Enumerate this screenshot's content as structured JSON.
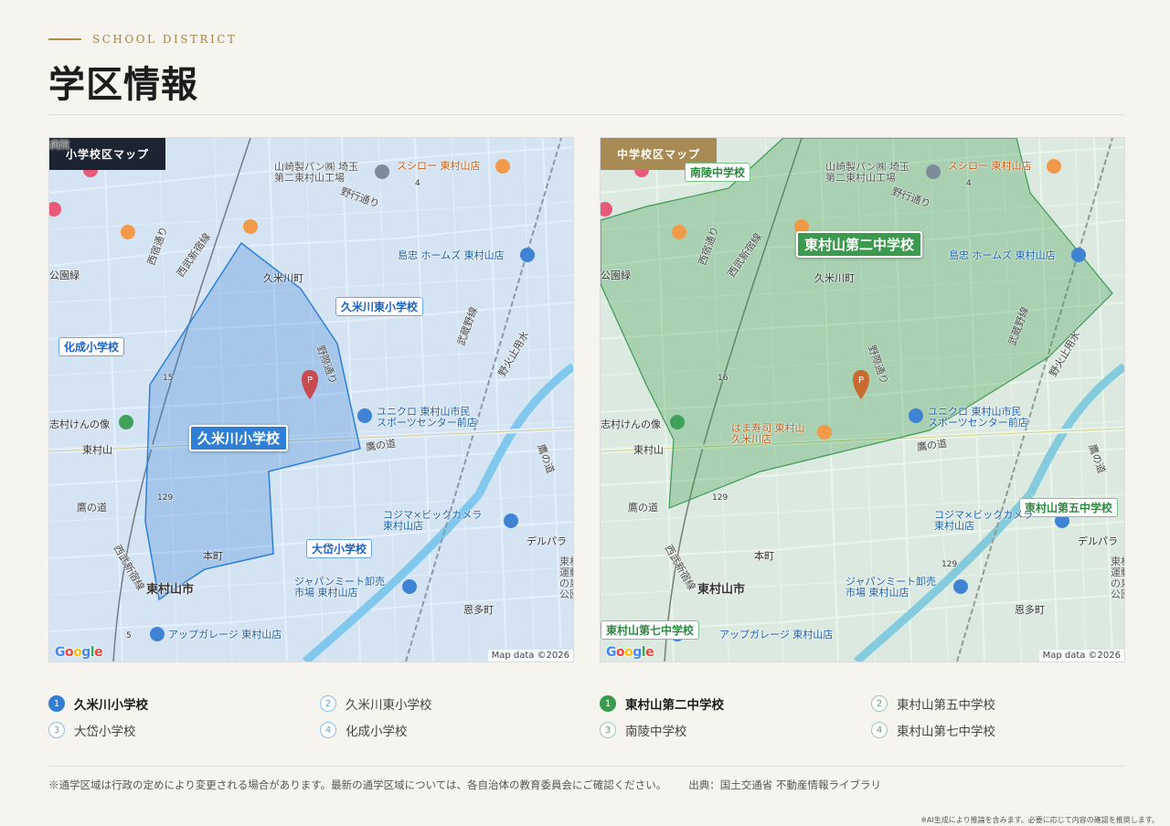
{
  "header": {
    "eyebrow": "SCHOOL DISTRICT",
    "title": "学区情報"
  },
  "maps": {
    "elementary": {
      "tag": "小学校区マップ",
      "primary_school": "久米川小学校",
      "school_labels": [
        "久米川東小学校",
        "化成小学校",
        "大岱小学校"
      ],
      "district_color": "#2f7fd6"
    },
    "middle": {
      "tag": "中学校区マップ",
      "primary_school": "東村山第二中学校",
      "school_labels": [
        "南陵中学校",
        "東村山第五中学校",
        "東村山第七中学校"
      ],
      "district_color": "#3c9a4f"
    },
    "common_labels": {
      "poi_bakery": "山崎製パン㈱ 埼玉\n第二東村山工場",
      "sushiro": "スシロー 東村山店",
      "shimachu": "島忠 ホームズ 東村山店",
      "uniqlo": "ユニクロ 東村山市民\nスポーツセンター前店",
      "kojima": "コジマ×ビックカメラ\n東村山店",
      "japan_meat": "ジャパンミート卸売\n市場 東村山店",
      "upgarage": "アップガレージ 東村山店",
      "hamazushi": "はま寿司 東村山\n久米川店",
      "kumegawa_town": "久米川町",
      "honmachi": "本町",
      "onta": "恩多町",
      "higashimurayama_city": "東村山市",
      "higashimurayama_station": "東村山",
      "nishijuku_dori": "西宿通り",
      "seibu_shinjuku": "西武新宿線",
      "seibu_shinjuku2": "西武新宿線",
      "musashino_line": "武蔵野線",
      "nobidome": "野火止用水",
      "yakou_dori": "野行通り",
      "nobi_dori": "野際通り",
      "takanomichi": "鷹の道",
      "takanomichi2": "鷹の道",
      "takanomichi3": "鷹の道",
      "shimura_ken": "志村けんの像",
      "derupara": "デルパラ",
      "park_edge": "公園緑",
      "hospital_edge": "病院",
      "higashi_edge": "東村\n運動\nの泉\n公園",
      "route_4": "4",
      "route_15": "15",
      "route_16": "16",
      "route_129": "129",
      "route_5": "5"
    },
    "attribution": "Map data ©2026",
    "google": [
      "G",
      "o",
      "o",
      "g",
      "l",
      "e"
    ]
  },
  "legend": {
    "elementary": [
      "久米川小学校",
      "久米川東小学校",
      "大岱小学校",
      "化成小学校"
    ],
    "middle": [
      "東村山第二中学校",
      "東村山第五中学校",
      "南陵中学校",
      "東村山第七中学校"
    ]
  },
  "notes": {
    "disclaimer": "※通学区域は行政の定めにより変更される場合があります。最新の通学区域については、各自治体の教育委員会にご確認ください。",
    "source": "出典：国土交通省 不動産情報ライブラリ",
    "ai_note": "※AI生成により推論を含みます。必要に応じて内容の確認を推奨します。"
  }
}
